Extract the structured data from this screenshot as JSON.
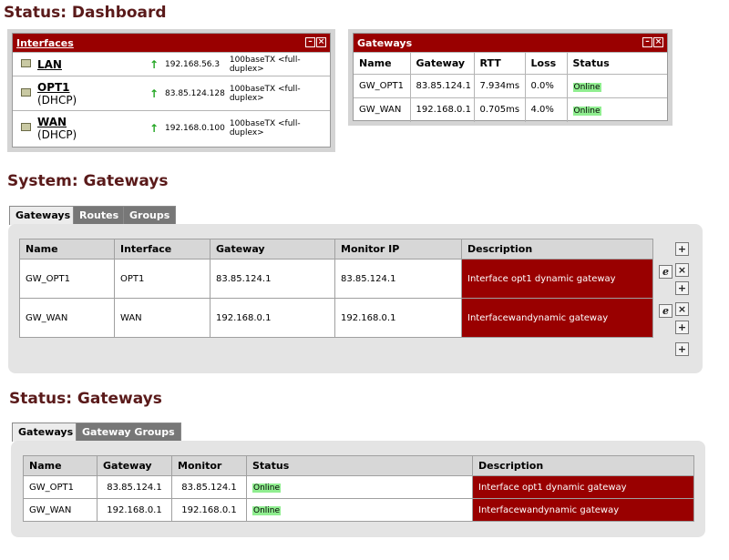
{
  "dashboard": {
    "title": "Status: Dashboard",
    "interfaces_widget": {
      "title": "Interfaces",
      "rows": [
        {
          "name": "LAN",
          "sub": "",
          "ip": "192.168.56.3",
          "media": "100baseTX <full-duplex>"
        },
        {
          "name": "OPT1",
          "sub": "(DHCP)",
          "ip": "83.85.124.128",
          "media": "100baseTX <full-duplex>"
        },
        {
          "name": "WAN",
          "sub": "(DHCP)",
          "ip": "192.168.0.100",
          "media": "100baseTX <full-duplex>"
        }
      ]
    },
    "gateways_widget": {
      "title": "Gateways",
      "headers": [
        "Name",
        "Gateway",
        "RTT",
        "Loss",
        "Status"
      ],
      "rows": [
        {
          "name": "GW_OPT1",
          "gateway": "83.85.124.1",
          "rtt": "7.934ms",
          "loss": "0.0%",
          "status": "Online"
        },
        {
          "name": "GW_WAN",
          "gateway": "192.168.0.1",
          "rtt": "0.705ms",
          "loss": "4.0%",
          "status": "Online"
        }
      ]
    },
    "minimize_glyph": "–",
    "close_glyph": "×"
  },
  "system_gateways": {
    "title": "System: Gateways",
    "tabs": [
      "Gateways",
      "Routes",
      "Groups"
    ],
    "headers": [
      "Name",
      "Interface",
      "Gateway",
      "Monitor IP",
      "Description"
    ],
    "rows": [
      {
        "name": "GW_OPT1",
        "interface": "OPT1",
        "gateway": "83.85.124.1",
        "monitor": "83.85.124.1",
        "description": "Interface opt1 dynamic gateway"
      },
      {
        "name": "GW_WAN",
        "interface": "WAN",
        "gateway": "192.168.0.1",
        "monitor": "192.168.0.1",
        "description": "Interfacewandynamic gateway"
      }
    ],
    "icons": {
      "add": "+",
      "edit": "e",
      "delete": "×"
    }
  },
  "status_gateways": {
    "title": "Status: Gateways",
    "tabs": [
      "Gateways",
      "Gateway Groups"
    ],
    "headers": [
      "Name",
      "Gateway",
      "Monitor",
      "Status",
      "Description"
    ],
    "rows": [
      {
        "name": "GW_OPT1",
        "gateway": "83.85.124.1",
        "monitor": "83.85.124.1",
        "status": "Online",
        "description": "Interface opt1 dynamic gateway"
      },
      {
        "name": "GW_WAN",
        "gateway": "192.168.0.1",
        "monitor": "192.168.0.1",
        "status": "Online",
        "description": "Interfacewandynamic gateway"
      }
    ]
  },
  "colors": {
    "accent": "#990000",
    "heading": "#5a1a1a",
    "online": "#90ee90",
    "tab_inactive": "#777777"
  }
}
